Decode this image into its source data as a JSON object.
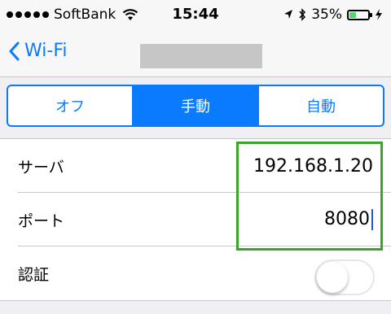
{
  "status": {
    "carrier": "SoftBank",
    "time": "15:44",
    "battery_percent": "35%"
  },
  "nav": {
    "back_label": "Wi-Fi"
  },
  "segment": {
    "options": [
      "オフ",
      "手動",
      "自動"
    ],
    "selected": "手動"
  },
  "fields": {
    "server": {
      "label": "サーバ",
      "value": "192.168.1.20"
    },
    "port": {
      "label": "ポート",
      "value": "8080"
    },
    "auth": {
      "label": "認証",
      "enabled": false
    }
  },
  "colors": {
    "accent": "#0a7aff",
    "highlight": "#3aa629",
    "battery": "#4cd964"
  }
}
